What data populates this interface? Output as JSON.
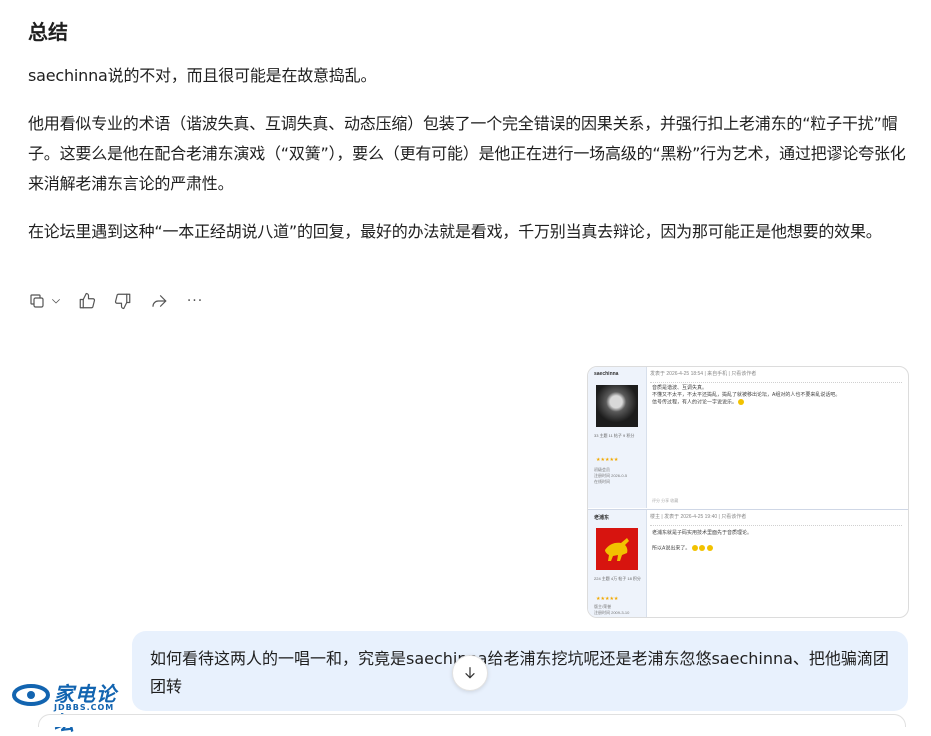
{
  "answer": {
    "heading": "总结",
    "paragraphs": [
      "saechinna说的不对，而且很可能是在故意捣乱。",
      "他用看似专业的术语（谐波失真、互调失真、动态压缩）包装了一个完全错误的因果关系，并强行扣上老浦东的“粒子干扰”帽子。这要么是他在配合老浦东演戏（“双簧”），要么（更有可能）是他正在进行一场高级的“黑粉”行为艺术，通过把谬论夸张化来消解老浦东言论的严肃性。",
      "在论坛里遇到这种“一本正经胡说八道”的回复，最好的办法就是看戏，千万别当真去辩论，因为那可能正是他想要的效果。"
    ]
  },
  "actions": {
    "icons": [
      "copy-icon",
      "chevron-down-icon",
      "thumbs-up-icon",
      "thumbs-down-icon",
      "share-icon",
      "more-icon"
    ],
    "more_glyph": "···"
  },
  "forum_card": {
    "post1": {
      "username": "saechinna",
      "header": "发表于 2026-4-25 18:54 | 来自手机 | 只看该作者",
      "stats": "33 主题  11 帖子  9 积分",
      "stars": "★★★★★",
      "meta": "初级会员\n注册时间 2026-0-5\n在线时间",
      "body": [
        "音质是谐波、互调失真。",
        "不懂又不太平，不太平还捣乱，捣乱了就被移出论坛，A组对的人也不要来乱说话吧。",
        "信号传过程，有人的讨论一字说说乐。"
      ],
      "foot": "评分  分享  收藏"
    },
    "post2": {
      "username": "老浦东",
      "header": "楼主 | 发表于 2026-4-25 19:40 | 只看该作者",
      "stats": "224 主题  4万 帖子  18 积分",
      "stars": "★★★★★",
      "meta": "版主/荣誉\n注册时间 2009-3-10",
      "body": [
        "老浦东就是子码实用技术里面先于音质理论。",
        "所以A说出来了。"
      ]
    }
  },
  "user_message": {
    "text": "如何看待这两人的一唱一和，究竟是saechinna给老浦东挖坑呢还是老浦东忽悠saechinna、把他骗滴团团转"
  },
  "watermark": {
    "title": "家电论坛",
    "subtitle": "JDBBS.COM"
  },
  "colors": {
    "bubble_bg": "#e8f1fd",
    "watermark_blue": "#1264b0"
  }
}
